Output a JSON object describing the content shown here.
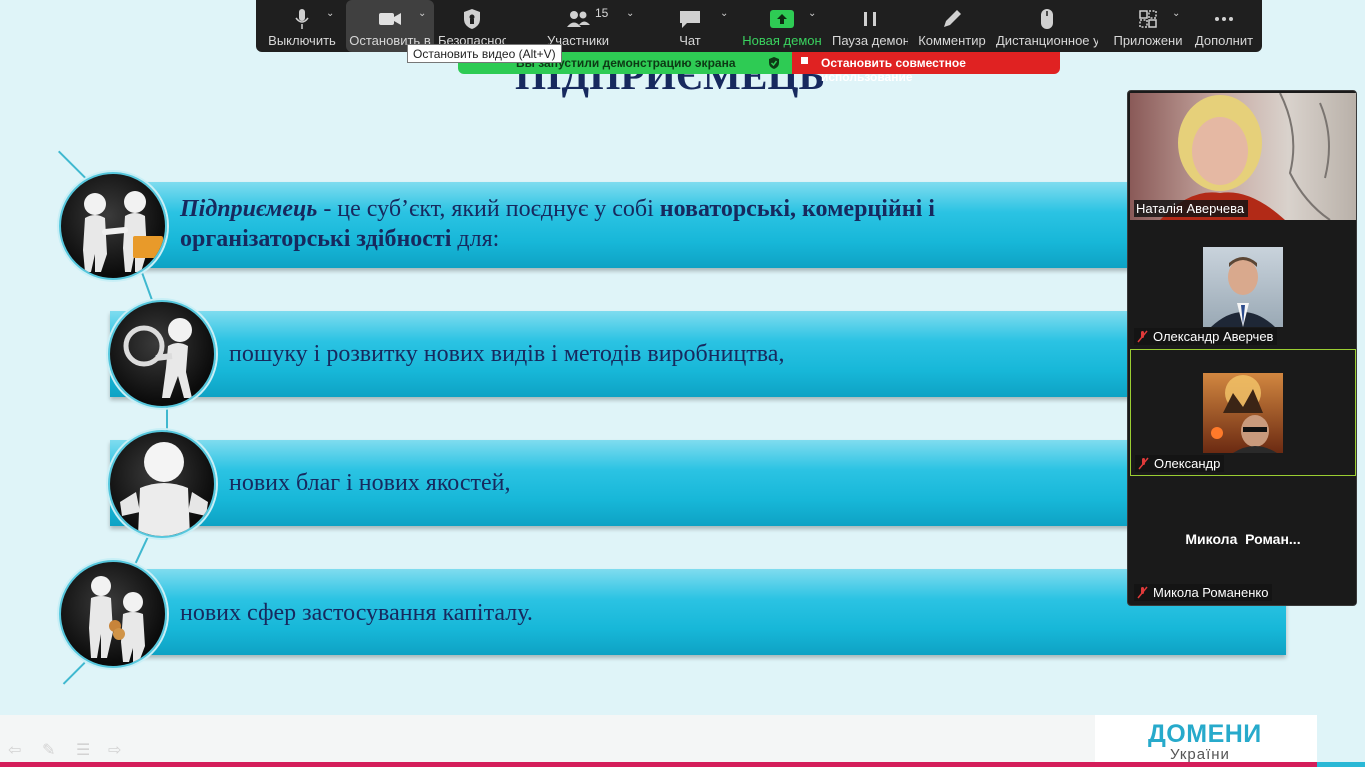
{
  "slide": {
    "title": "ПІДПРИЄМЕЦЬ",
    "items": [
      {
        "term": "Підприємець",
        "rest_1": " - це суб’єкт, який поєднує у собі ",
        "bold_1": "новаторські, комерційні і",
        "bold_2": "організаторські здібності",
        "rest_2": " для:"
      },
      {
        "text": "пошуку і розвитку нових видів і методів виробництва,"
      },
      {
        "text": "нових благ і нових якостей,"
      },
      {
        "text": "нових сфер застосування капіталу."
      }
    ]
  },
  "toolbar": {
    "buttons": [
      {
        "label": "Выключить",
        "icon": "microphone-icon"
      },
      {
        "label": "Остановить в",
        "icon": "video-camera-icon"
      },
      {
        "label": "Безопаснос",
        "icon": "shield-icon"
      },
      {
        "label": "Участники",
        "icon": "participants-icon"
      },
      {
        "label": "Чат",
        "icon": "chat-icon"
      },
      {
        "label": "Новая демон",
        "icon": "share-screen-icon"
      },
      {
        "label": "Пауза демон",
        "icon": "pause-icon"
      },
      {
        "label": "Комментир",
        "icon": "pencil-icon"
      },
      {
        "label": "Дистанционное у",
        "icon": "mouse-icon"
      },
      {
        "label": "Приложени",
        "icon": "apps-icon"
      },
      {
        "label": "Дополнит",
        "icon": "more-icon"
      }
    ],
    "participants_count": "15",
    "tooltip": "Остановить видео (Alt+V)",
    "colors": {
      "background": "#1f1f1f",
      "share_green": "#2ecb54"
    }
  },
  "share_banner": {
    "message": "Вы запустили демонстрацию экрана",
    "stop_label": "Остановить совместное использование"
  },
  "video_panel": {
    "participants": [
      {
        "name": "Наталія Аверчева",
        "muted": false
      },
      {
        "name": "Олександр Аверчев",
        "muted": true
      },
      {
        "name": "Олександр",
        "muted": true
      },
      {
        "name": "Микола Романенко",
        "display_name": "Микола  Роман...",
        "muted": true
      }
    ]
  },
  "footer": {
    "logo_main": "ДОМЕНИ",
    "logo_sub": "України"
  }
}
